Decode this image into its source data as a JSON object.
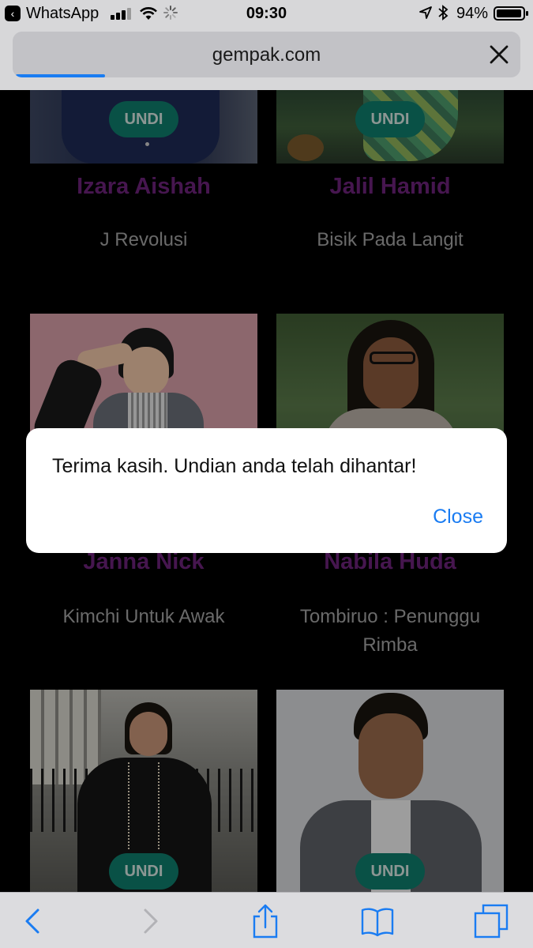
{
  "status_bar": {
    "back_app": "WhatsApp",
    "time": "09:30",
    "battery": "94%",
    "icons": [
      "back-to-app-icon",
      "signal-icon",
      "wifi-icon",
      "activity-spinner-icon",
      "location-icon",
      "bluetooth-icon",
      "battery-icon"
    ]
  },
  "browser": {
    "url": "gempak.com",
    "load_progress": 0.16,
    "close_icon": "close-icon"
  },
  "vote_label": "UNDI",
  "cards": [
    {
      "name": "Izara Aishah",
      "show": "J Revolusi"
    },
    {
      "name": "Jalil Hamid",
      "show": "Bisik Pada Langit"
    },
    {
      "name": "Janna Nick",
      "show": "Kimchi Untuk Awak"
    },
    {
      "name": "Nabila Huda",
      "show": "Tombiruo : Penunggu Rimba"
    },
    {
      "name": "",
      "show": ""
    },
    {
      "name": "",
      "show": ""
    }
  ],
  "dialog": {
    "message": "Terima kasih. Undian anda telah dihantar!",
    "close_label": "Close"
  },
  "toolbar": {
    "icons": [
      "back-icon",
      "forward-icon",
      "share-icon",
      "bookmarks-icon",
      "tabs-icon"
    ]
  },
  "colors": {
    "accent": "#1a7cf2",
    "vote_button": "#0f7d6c",
    "name_text": "#6c237a",
    "show_text": "#a4a4a4"
  }
}
